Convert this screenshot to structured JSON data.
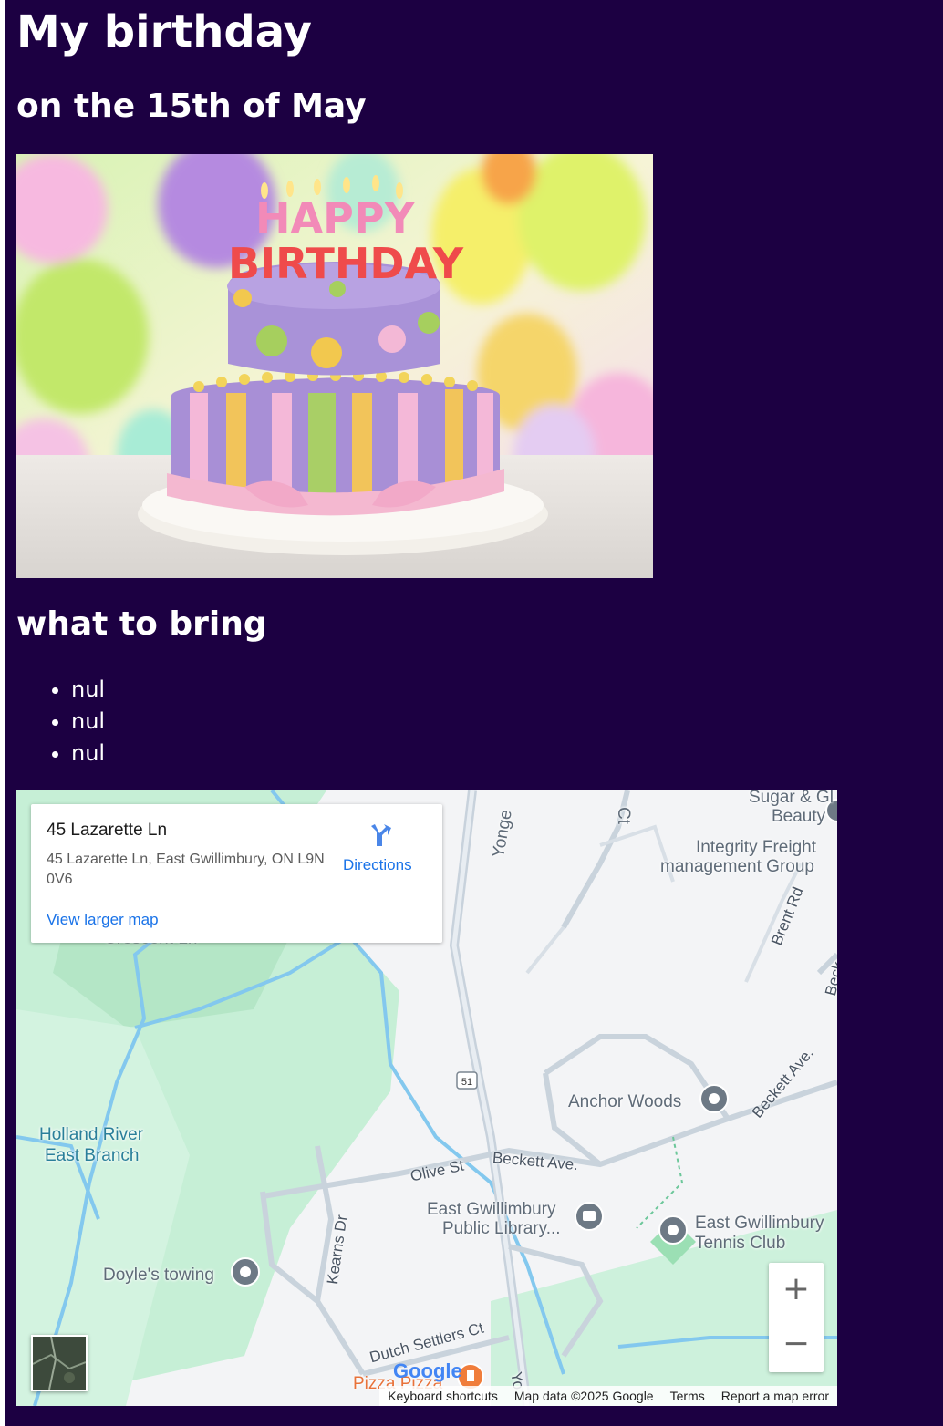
{
  "page": {
    "title": "My birthday",
    "date": "on the 15th of May",
    "bring_heading": "what to bring",
    "bring_items": [
      "nul",
      "nul",
      "nul"
    ]
  },
  "photo": {
    "cake_text_line1": "HAPPY",
    "cake_text_line2": "BIRTHDAY"
  },
  "map": {
    "card": {
      "place_name": "45 Lazarette Ln",
      "address": "45 Lazarette Ln, East Gwillimbury, ON L9N 0V6",
      "directions_label": "Directions",
      "larger_map_label": "View larger map"
    },
    "labels": {
      "yonge": "Yonge",
      "ct": "Ct",
      "sugar": "Sugar & Gl",
      "beauty": "Beauty",
      "integrity1": "Integrity Freight",
      "integrity2": "management Group",
      "brent": "Brent Rd",
      "beck": "Beck",
      "anchor": "Anchor Woods",
      "beckett1": "Beckett Ave.",
      "beckett2": "Beckett Ave.",
      "holland1": "Holland River",
      "holland2": "East Branch",
      "olive": "Olive St",
      "library1": "East Gwillimbury",
      "library2": "Public Library...",
      "tennis1": "East Gwillimbury",
      "tennis2": "Tennis Club",
      "kearns": "Kearns Dr",
      "doyle": "Doyle's towing",
      "dutch": "Dutch Settlers Ct",
      "pizza": "Pizza Pizza",
      "route": "51",
      "yo": "Yo",
      "cut_label": "Crescent Ln",
      "google": "Google"
    },
    "zoom_in": "+",
    "zoom_out": "−",
    "footer": {
      "shortcuts": "Keyboard shortcuts",
      "mapdata": "Map data ©2025 Google",
      "terms": "Terms",
      "report": "Report a map error"
    }
  }
}
